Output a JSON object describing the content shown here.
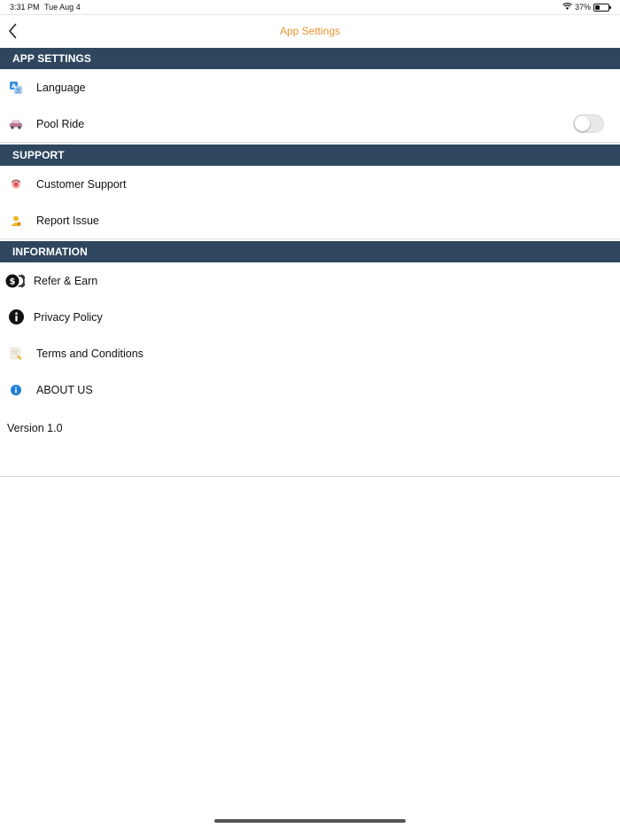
{
  "status_bar": {
    "time": "3:31 PM",
    "date": "Tue Aug 4",
    "battery": "37%",
    "battery_level": 0.37
  },
  "nav": {
    "title": "App Settings"
  },
  "sections": {
    "app_settings": {
      "header": "APP SETTINGS",
      "items": [
        {
          "label": "Language",
          "icon": "translate-icon"
        },
        {
          "label": "Pool Ride",
          "icon": "car-icon",
          "toggle_on": false
        }
      ]
    },
    "support": {
      "header": "SUPPORT",
      "items": [
        {
          "label": "Customer Support",
          "icon": "support-icon"
        },
        {
          "label": "Report Issue",
          "icon": "report-issue-icon"
        }
      ]
    },
    "information": {
      "header": "INFORMATION",
      "items": [
        {
          "label": "Refer & Earn",
          "icon": "coins-icon"
        },
        {
          "label": "Privacy Policy",
          "icon": "info-black-icon"
        },
        {
          "label": "Terms and Conditions",
          "icon": "document-icon"
        },
        {
          "label": "ABOUT US",
          "icon": "info-blue-icon"
        }
      ]
    }
  },
  "version": "Version 1.0",
  "colors": {
    "accent": "#e8952f",
    "header_bg": "#2f475e",
    "header_text": "#ffffff"
  }
}
